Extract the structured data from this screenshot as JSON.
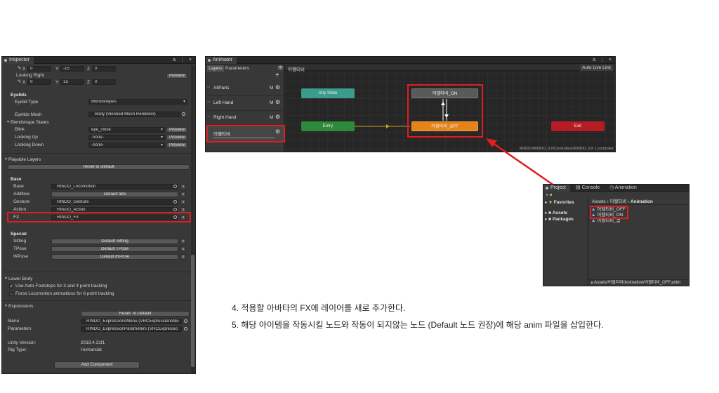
{
  "inspector": {
    "tab_title": "Inspector",
    "window_buttons": "a ⋮ ×",
    "lookat_top": {
      "x_label": "X",
      "x_value": "0",
      "y_label": "Y",
      "y_value": "-15",
      "z_label": "Z",
      "z_value": "0"
    },
    "looking_right": "Looking Right",
    "preview": "Preview",
    "lookat_right": {
      "x_label": "X",
      "x_value": "0",
      "y_label": "Y",
      "y_value": "15",
      "z_label": "Z",
      "z_value": "0"
    },
    "eyelids_header": "Eyelids",
    "eyelid_type_label": "Eyelid Type",
    "eyelid_type_value": "Blendshapes",
    "eyelids_mesh_label": "Eyelids Mesh",
    "eyelids_mesh_value": "Body (Skinned Mesh Renderer)",
    "blendshape_states": "Blendshape States",
    "blink_label": "Blink",
    "blink_value": "eye_close",
    "looking_up_label": "Looking Up",
    "looking_up_value": "-none-",
    "looking_down_label": "Looking Down",
    "looking_down_value": "-none-",
    "playable_layers": "Playable Layers",
    "reset_to_default": "Reset to Default",
    "base_header": "Base",
    "base_rows": [
      {
        "label": "Base",
        "value": "RINDO_Locomotion"
      },
      {
        "label": "Additive",
        "value": "Default Idle"
      },
      {
        "label": "Gesture",
        "value": "RINDO_Gesture"
      },
      {
        "label": "Action",
        "value": "RINDO_Action"
      },
      {
        "label": "FX",
        "value": "RINDO_FX"
      }
    ],
    "remove_glyph": "x",
    "special_header": "Special",
    "special_rows": [
      {
        "label": "Sitting",
        "value": "Default Sitting"
      },
      {
        "label": "TPose",
        "value": "Default TPose"
      },
      {
        "label": "IKPose",
        "value": "Default IKPose"
      }
    ],
    "lower_body": "Lower Body",
    "auto_footsteps": "Use Auto-Footsteps for 3 and 4 point tracking",
    "force_locomotion": "Force Locomotion animations for 6 point tracking",
    "expressions": "Expressions",
    "reset_to_default_2": "Reset To Default",
    "menu_label": "Menu",
    "menu_value": "RINDO_ExpressionsMenu (VRCExpressionsMe",
    "parameters_label": "Parameters",
    "parameters_value": "RINDO_ExpressionParameters (VRCExpressio",
    "unity_version_label": "Unity Version:",
    "unity_version_value": "2019.4.31f1",
    "rig_type_label": "Rig Type:",
    "rig_type_value": "Humanoid",
    "add_component": "Add Component"
  },
  "animator": {
    "tab_title": "Animator",
    "window_buttons": "a ⋮ ×",
    "tab_layers": "Layers",
    "tab_parameters": "Parameters",
    "breadcrumb": "어헬티비",
    "auto_live_link": "Auto Live Link",
    "add_glyph": "+",
    "layers": [
      {
        "name": "AllParts",
        "m": "M"
      },
      {
        "name": "Left Hand",
        "m": "M"
      },
      {
        "name": "Right Hand",
        "m": "M"
      },
      {
        "name": "어헬티비",
        "m": ""
      }
    ],
    "nodes": {
      "any_state": "Any State",
      "entry": "Entry",
      "exit": "Exit",
      "on": "어헬티비_ON",
      "off": "어헬티비_OFF"
    },
    "path": "RINDO/RINDO_3.0/Controllers/RINDO_FX 1.controller"
  },
  "project": {
    "tab_project": "Project",
    "tab_console": "Console",
    "tab_animation": "Animation",
    "add_glyph": "+ ▾",
    "favorites": "Favorites",
    "assets": "Assets",
    "packages": "Packages",
    "breadcrumb": [
      "Assets",
      "어헬티비",
      "Animation"
    ],
    "files": [
      "어헬티비_OFF",
      "어헬티비_ON",
      "어헬티비_콤"
    ],
    "status_path": "Assets/어헬티비/Animation/어헬티비_OFF.anim"
  },
  "captions": {
    "step4": "4. 적용할 아바타의 FX에 레이어를 새로 추가한다.",
    "step5": "5. 해당 아이템을 작동시킬 노드와 작동이 되지않는 노드 (Default 노드 권장)에 해당 anim 파일을 삽입한다."
  },
  "colors": {
    "highlight": "#e11d22",
    "any_state": "#3c9c8c",
    "entry": "#2d8a3a",
    "exit": "#b51c24",
    "off_state": "#e6821a",
    "on_state": "#5a5a5a"
  }
}
